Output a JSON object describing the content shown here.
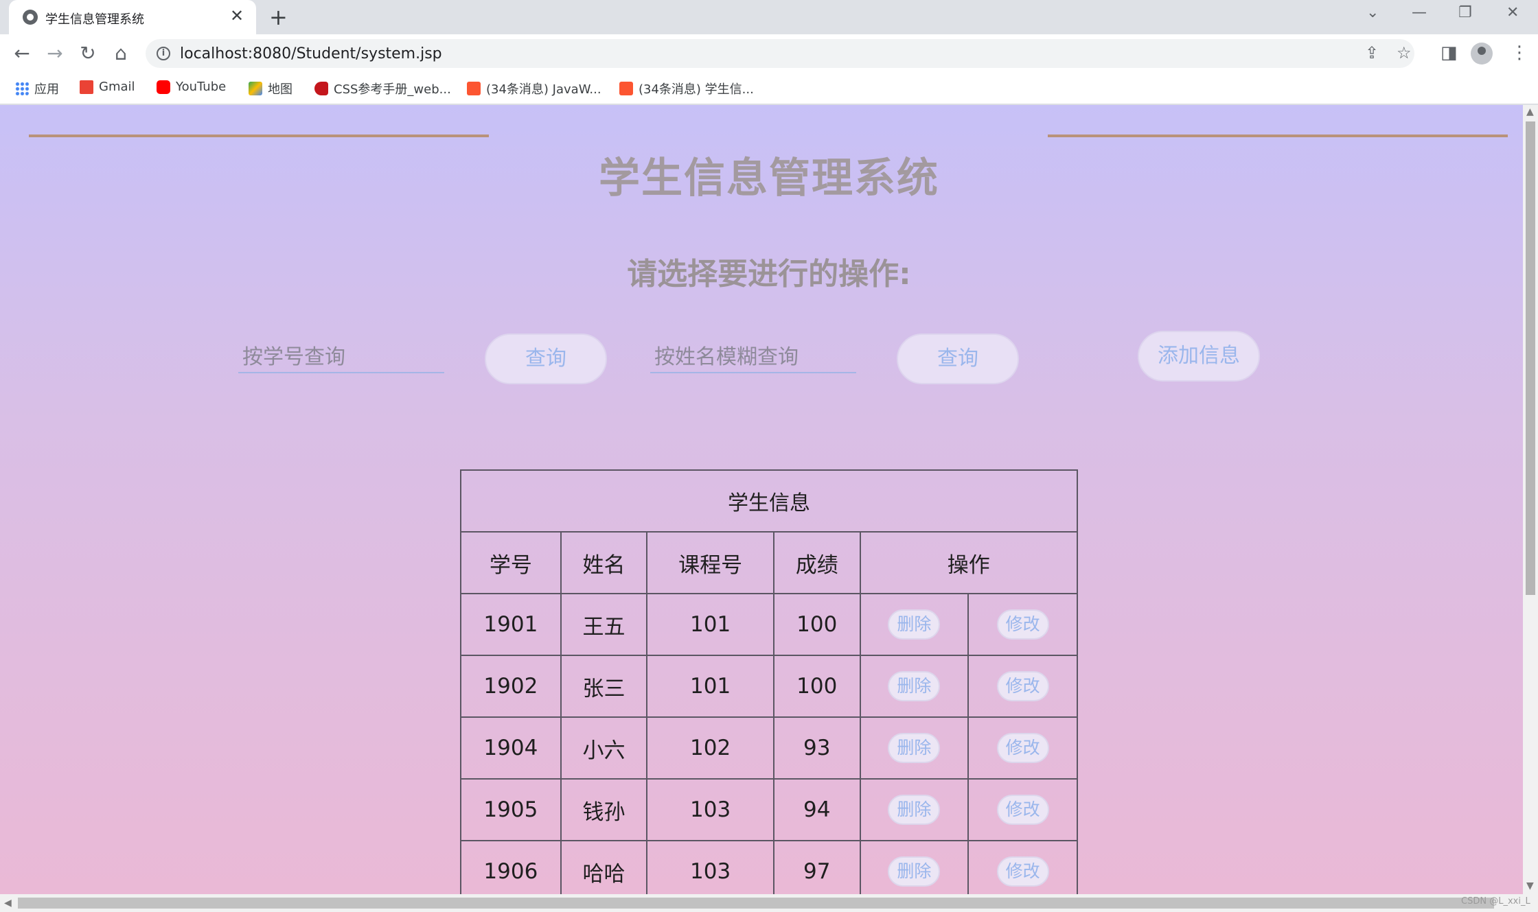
{
  "browser": {
    "tab_title": "学生信息管理系统",
    "tab_close": "✕",
    "new_tab": "+",
    "url": "localhost:8080/Student/system.jsp",
    "bookmarks": [
      {
        "label": "应用",
        "color": "#4285f4"
      },
      {
        "label": "Gmail",
        "color": "#ea4335"
      },
      {
        "label": "YouTube",
        "color": "#ff0000"
      },
      {
        "label": "地图",
        "color": "#34a853"
      },
      {
        "label": "CSS参考手册_web...",
        "color": "#c4161c"
      },
      {
        "label": "(34条消息) JavaW...",
        "color": "#fc5531"
      },
      {
        "label": "(34条消息) 学生信...",
        "color": "#fc5531"
      }
    ]
  },
  "page": {
    "title": "学生信息管理系统",
    "subtitle": "请选择要进行的操作:",
    "search_id_placeholder": "按学号查询",
    "search_name_placeholder": "按姓名模糊查询",
    "query_label": "查询",
    "add_label": "添加信息"
  },
  "table": {
    "caption": "学生信息",
    "headers": [
      "学号",
      "姓名",
      "课程号",
      "成绩",
      "操作"
    ],
    "delete_label": "删除",
    "edit_label": "修改",
    "rows": [
      {
        "id": "1901",
        "name": "王五",
        "course": "101",
        "score": "100"
      },
      {
        "id": "1902",
        "name": "张三",
        "course": "101",
        "score": "100"
      },
      {
        "id": "1904",
        "name": "小六",
        "course": "102",
        "score": "93"
      },
      {
        "id": "1905",
        "name": "钱孙",
        "course": "103",
        "score": "94"
      },
      {
        "id": "1906",
        "name": "哈哈",
        "course": "103",
        "score": "97"
      }
    ]
  },
  "watermark": "CSDN @L_xxi_L"
}
